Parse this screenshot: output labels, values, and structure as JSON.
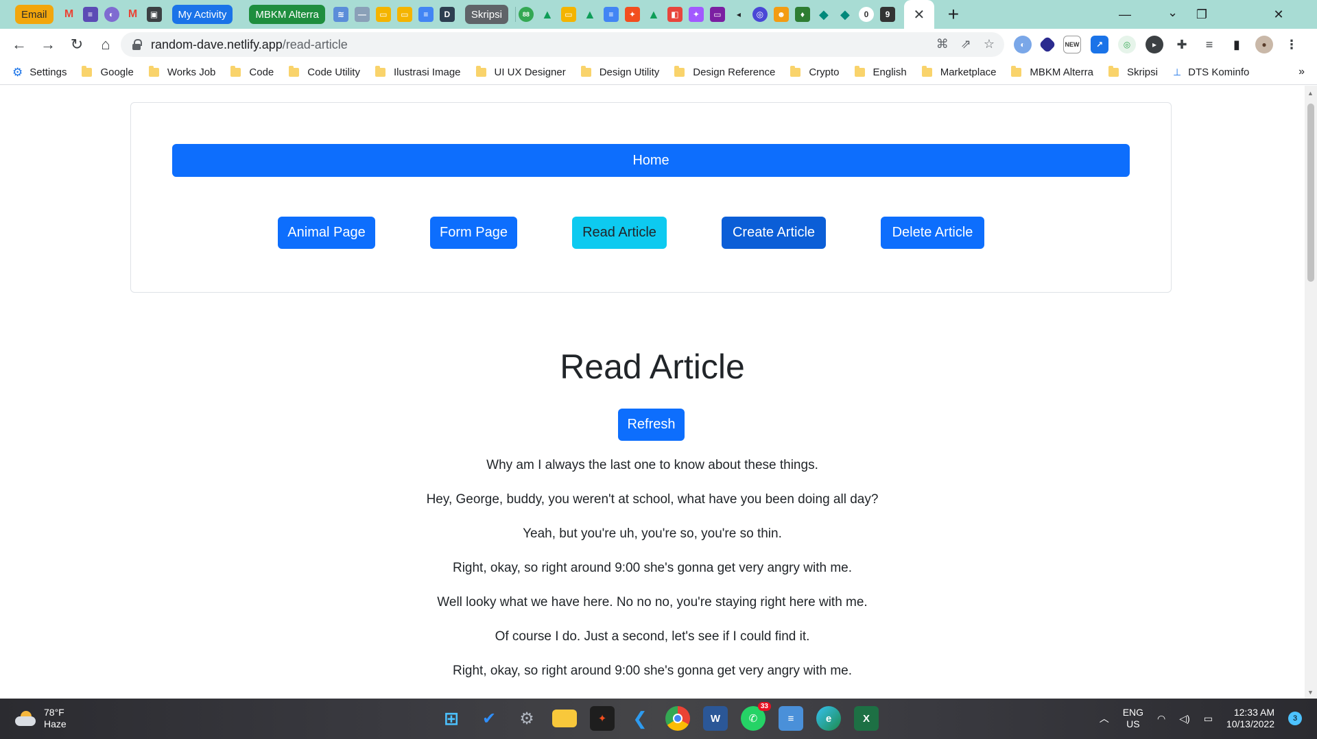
{
  "browser": {
    "tab_groups": [
      "Email",
      "My Activity",
      "MBKM Alterra",
      "Skripsi"
    ],
    "colors": {
      "tabstrip": "#a8dcd4",
      "email_group": "#f2a60c",
      "activity_group": "#1a73e8",
      "mbkm_group": "#1e8e3e",
      "skripsi_group": "#5f6368"
    },
    "url_host": "random-dave.netlify.app",
    "url_path": "/read-article"
  },
  "bookmarks": [
    "Settings",
    "Google",
    "Works Job",
    "Code",
    "Code Utility",
    "Ilustrasi Image",
    "UI UX Designer",
    "Design Utility",
    "Design Reference",
    "Crypto",
    "English",
    "Marketplace",
    "MBKM Alterra",
    "Skripsi",
    "DTS Kominfo"
  ],
  "nav": {
    "home": "Home",
    "buttons": [
      "Animal Page",
      "Form Page",
      "Read Article",
      "Create Article",
      "Delete Article"
    ],
    "colors": {
      "primary": "#0d6efd",
      "active": "#0dcaf0",
      "pressed": "#0b5ed7"
    }
  },
  "main": {
    "title": "Read Article",
    "refresh": "Refresh",
    "articles": [
      "Why am I always the last one to know about these things.",
      "Hey, George, buddy, you weren't at school, what have you been doing all day?",
      "Yeah, but you're uh, you're so, you're so thin.",
      "Right, okay, so right around 9:00 she's gonna get very angry with me.",
      "Well looky what we have here. No no no, you're staying right here with me.",
      "Of course I do. Just a second, let's see if I could find it.",
      "Right, okay, so right around 9:00 she's gonna get very angry with me."
    ]
  },
  "taskbar": {
    "temp": "78°F",
    "weather": "Haze",
    "whatsapp_badge": "33",
    "lang": "ENG",
    "region": "US",
    "time": "12:33 AM",
    "date": "10/13/2022",
    "notifications": "3"
  }
}
